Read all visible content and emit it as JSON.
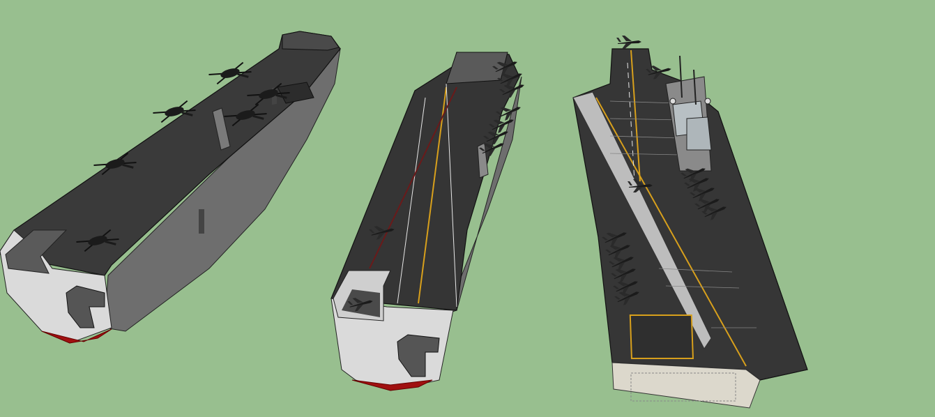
{
  "scene": {
    "background": "#98bf8f",
    "objects": [
      {
        "name": "amphibious-assault-ship-model",
        "aircraft_type": "helicopter",
        "aircraft_count": 5,
        "island": "small-pillar"
      },
      {
        "name": "angled-deck-carrier-model",
        "aircraft_type": "jet",
        "aircraft_count": 13,
        "island": "small-pillar"
      },
      {
        "name": "full-detail-carrier-model",
        "aircraft_type": "jet",
        "aircraft_count": 18,
        "island": "full-superstructure"
      }
    ]
  },
  "colors": {
    "deck": "#3b3b3b",
    "deck_dark": "#2e2e2e",
    "hull_side": "#707070",
    "hull_front": "#dcdcdc",
    "keel": "#a01010",
    "deck_line_yellow": "#d8a01c",
    "deck_line_white": "#e8e8e8"
  }
}
